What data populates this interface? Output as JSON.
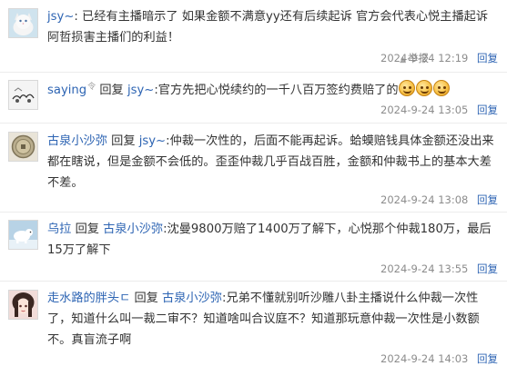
{
  "posts": [
    {
      "user": "jsy~",
      "separator": ":",
      "text": "已经有主播暗示了 如果金额不满意yy还有后续起诉 官方会代表心悦主播起诉阿哲损害主播们的利益！",
      "report_label": "举报",
      "time": "2024-9-24 12:19",
      "action": "回复",
      "avatar_icon": "cat-avatar-icon"
    },
    {
      "user": "saying",
      "level": "令",
      "reply_word": "回复",
      "target": "jsy~",
      "separator": ":",
      "text": "官方先把心悦续约的一千八百万签约费赔了的",
      "emoji_count": 3,
      "time": "2024-9-24 13:05",
      "action": "回复",
      "avatar_icon": "doodle-avatar-icon"
    },
    {
      "user": "古泉小沙弥",
      "reply_word": "回复",
      "target": "jsy~",
      "separator": ":",
      "text": "仲裁一次性的，后面不能再起诉。蛤蟆赔钱具体金额还没出来都在瞎说，但是金额不会低的。歪歪仲裁几乎百战百胜，金额和仲裁书上的基本大差不差。",
      "time": "2024-9-24 13:08",
      "action": "回复",
      "avatar_icon": "coin-avatar-icon"
    },
    {
      "user": "乌拉",
      "reply_word": "回复",
      "target": "古泉小沙弥",
      "separator": ":",
      "text": "沈曼9800万赔了1400万了解下，心悦那个仲裁180万，最后15万了解下",
      "time": "2024-9-24 13:55",
      "action": "回复",
      "avatar_icon": "polar-bear-avatar-icon"
    },
    {
      "user": "走水路的胖头ㄷ",
      "reply_word": "回复",
      "target": "古泉小沙弥",
      "separator": ":",
      "text": "兄弟不懂就别听沙雕八卦主播说什么仲裁一次性了，知道什么叫一裁二审不？知道啥叫合议庭不？知道那玩意仲裁一次性是小数额不。真盲流子啊",
      "time": "2024-9-24 14:03",
      "action": "回复",
      "avatar_icon": "anime-girl-avatar-icon"
    }
  ],
  "colors": {
    "link": "#2d64b3",
    "text": "#333333",
    "meta": "#8c8c8c",
    "divider": "#ececec"
  }
}
